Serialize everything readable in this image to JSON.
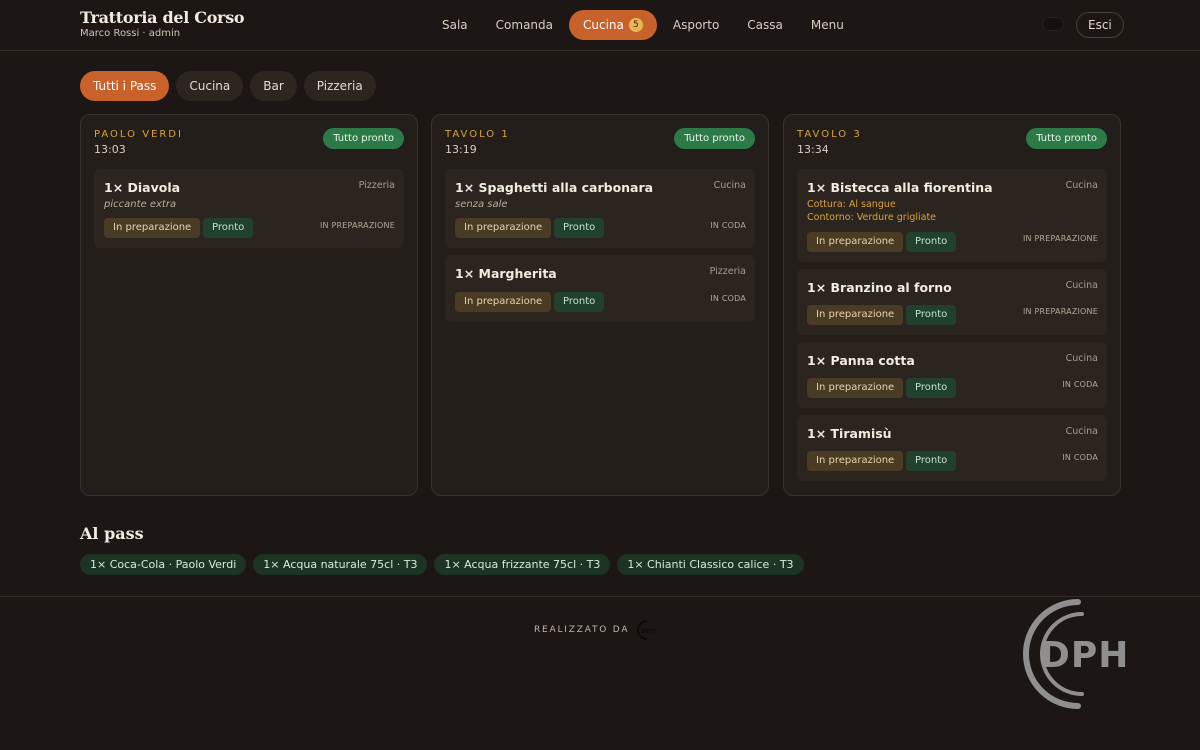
{
  "header": {
    "title": "Trattoria del Corso",
    "user": "Marco Rossi · admin",
    "nav": [
      {
        "label": "Sala"
      },
      {
        "label": "Comanda"
      },
      {
        "label": "Cucina",
        "badge": "5",
        "active": true
      },
      {
        "label": "Asporto"
      },
      {
        "label": "Cassa"
      },
      {
        "label": "Menu"
      }
    ],
    "logout_label": "Esci"
  },
  "filters": [
    "Tutti i Pass",
    "Cucina",
    "Bar",
    "Pizzeria"
  ],
  "columns": [
    {
      "name": "PAOLO VERDI",
      "time": "13:03",
      "badge": "Tutto pronto",
      "orders": [
        {
          "title": "1× Diavola",
          "station": "Pizzeria",
          "note": "piccante extra",
          "status": "IN PREPARAZIONE"
        }
      ]
    },
    {
      "name": "TAVOLO 1",
      "time": "13:19",
      "badge": "Tutto pronto",
      "orders": [
        {
          "title": "1× Spaghetti alla carbonara",
          "station": "Cucina",
          "note": "senza sale",
          "status": "IN CODA"
        },
        {
          "title": "1× Margherita",
          "station": "Pizzeria",
          "status": "IN CODA"
        }
      ]
    },
    {
      "name": "TAVOLO 3",
      "time": "13:34",
      "badge": "Tutto pronto",
      "orders": [
        {
          "title": "1× Bistecca alla fiorentina",
          "station": "Cucina",
          "mods": [
            "Cottura: Al sangue",
            "Contorno: Verdure grigliate"
          ],
          "status": "IN PREPARAZIONE"
        },
        {
          "title": "1× Branzino al forno",
          "station": "Cucina",
          "status": "IN PREPARAZIONE"
        },
        {
          "title": "1× Panna cotta",
          "station": "Cucina",
          "status": "IN CODA"
        },
        {
          "title": "1× Tiramisù",
          "station": "Cucina",
          "status": "IN CODA"
        }
      ]
    }
  ],
  "actions": {
    "prep_label": "In preparazione",
    "ready_label": "Pronto"
  },
  "pass": {
    "title": "Al pass",
    "items": [
      "1× Coca-Cola · Paolo Verdi",
      "1× Acqua naturale 75cl · T3",
      "1× Acqua frizzante 75cl · T3",
      "1× Chianti Classico calice · T3"
    ]
  },
  "footer": {
    "credit": "REALIZZATO DA",
    "logo_text": "DPH"
  },
  "theme": {
    "accent": "#c9622a",
    "gold": "#d9a23f",
    "success": "#2b7a47",
    "background": "#1c1714"
  }
}
